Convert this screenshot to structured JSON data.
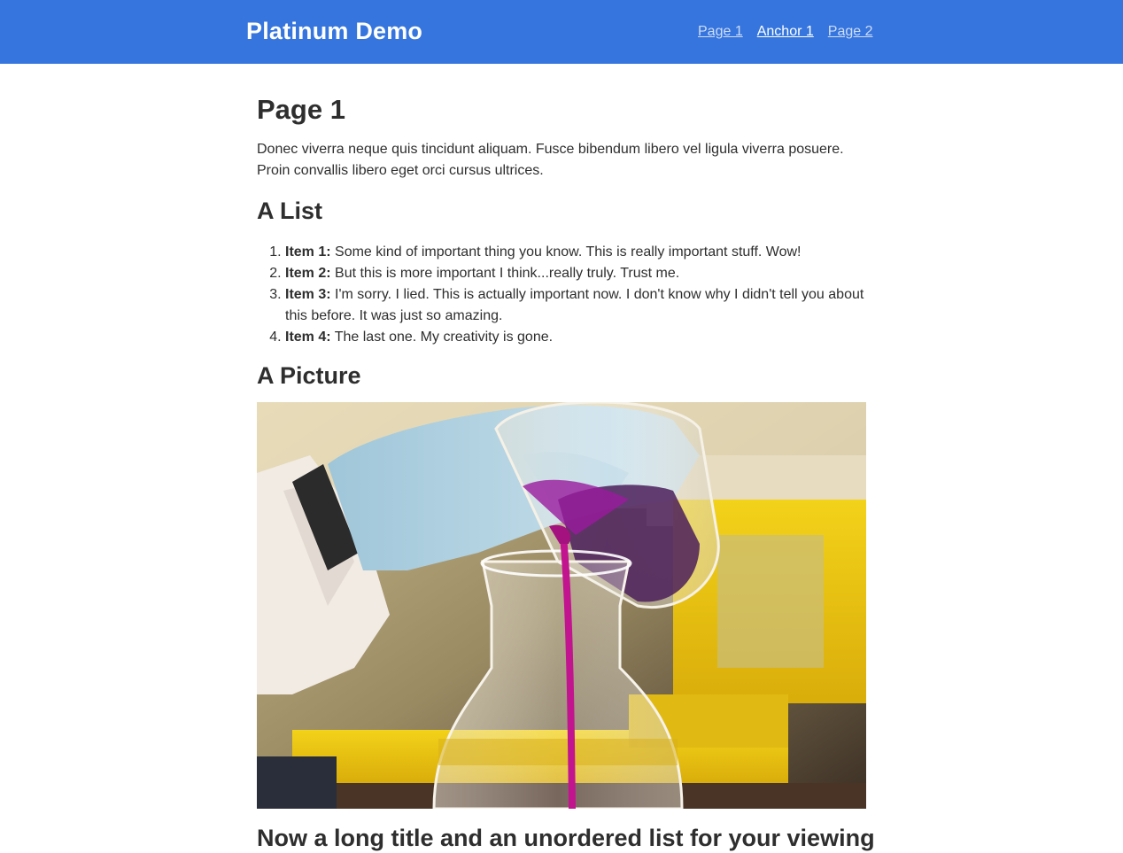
{
  "header": {
    "brand": "Platinum Demo",
    "nav": [
      {
        "label": "Page 1",
        "state": "visited"
      },
      {
        "label": "Anchor 1",
        "state": "current"
      },
      {
        "label": "Page 2",
        "state": "visited"
      }
    ],
    "accent_color": "#3575dd"
  },
  "main": {
    "title": "Page 1",
    "intro": "Donec viverra neque quis tincidunt aliquam. Fusce bibendum libero vel ligula viverra posuere. Proin convallis libero eget orci cursus ultrices.",
    "list_heading": "A List",
    "list_items": [
      {
        "label": "Item 1:",
        "text": " Some kind of important thing you know. This is really important stuff. Wow!"
      },
      {
        "label": "Item 2:",
        "text": " But this is more important I think...really truly. Trust me."
      },
      {
        "label": "Item 3:",
        "text": " I'm sorry. I lied. This is actually important now. I don't know why I didn't tell you about this before. It was just so amazing."
      },
      {
        "label": "Item 4:",
        "text": " The last one. My creativity is gone."
      }
    ],
    "picture_heading": "A Picture",
    "long_heading": "Now a long title and an unordered list for your viewing"
  }
}
